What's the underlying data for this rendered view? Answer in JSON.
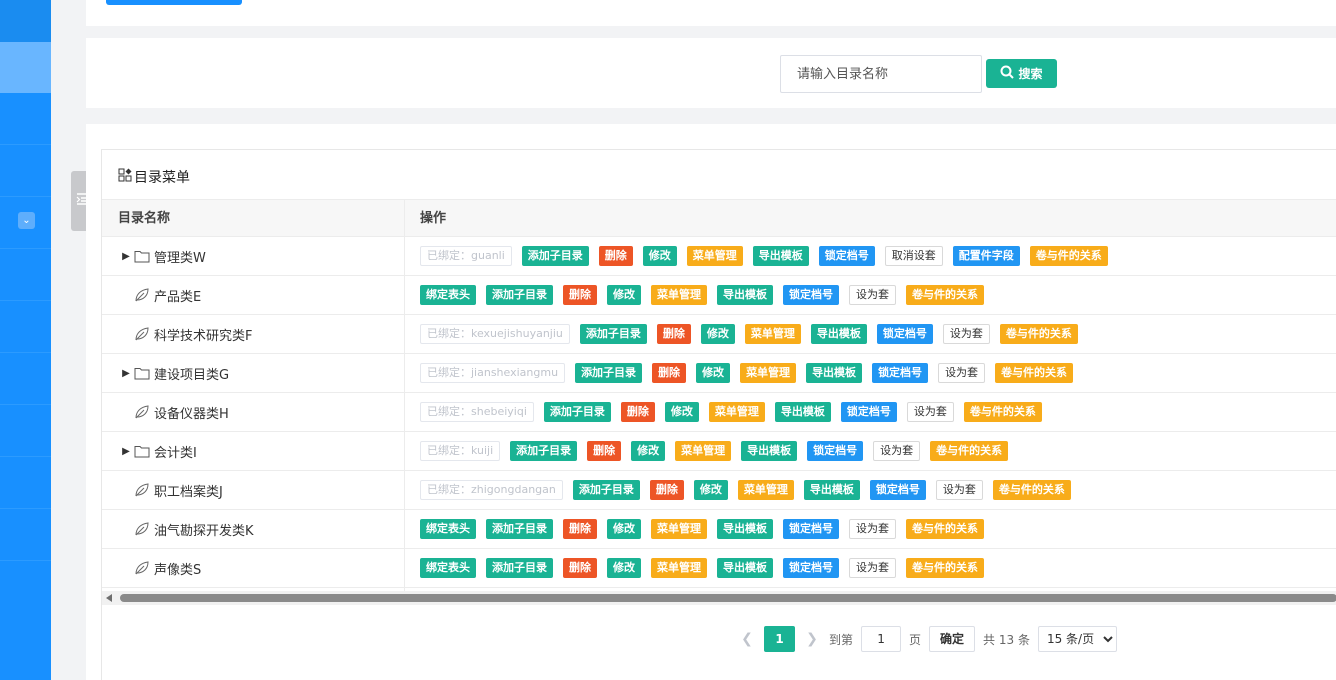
{
  "search": {
    "placeholder": "请输入目录名称",
    "button_label": "搜索"
  },
  "panel": {
    "title": "目录菜单"
  },
  "table": {
    "columns": [
      "目录名称",
      "操作"
    ],
    "rows": [
      {
        "name": "管理类W",
        "expandable": true,
        "icon": "folder-icon",
        "actions": [
          {
            "label": "已绑定：guanli",
            "style": "disabled"
          },
          {
            "label": "添加子目录",
            "style": "teal"
          },
          {
            "label": "删除",
            "style": "red"
          },
          {
            "label": "修改",
            "style": "teal"
          },
          {
            "label": "菜单管理",
            "style": "orange"
          },
          {
            "label": "导出模板",
            "style": "teal"
          },
          {
            "label": "锁定档号",
            "style": "blue"
          },
          {
            "label": "取消设套",
            "style": "outline"
          },
          {
            "label": "配置件字段",
            "style": "blue"
          },
          {
            "label": "卷与件的关系",
            "style": "orange"
          }
        ]
      },
      {
        "name": "产品类E",
        "expandable": false,
        "icon": "leaf-icon",
        "actions": [
          {
            "label": "绑定表头",
            "style": "teal"
          },
          {
            "label": "添加子目录",
            "style": "teal"
          },
          {
            "label": "删除",
            "style": "red"
          },
          {
            "label": "修改",
            "style": "teal"
          },
          {
            "label": "菜单管理",
            "style": "orange"
          },
          {
            "label": "导出模板",
            "style": "teal"
          },
          {
            "label": "锁定档号",
            "style": "blue"
          },
          {
            "label": "设为套",
            "style": "outline"
          },
          {
            "label": "卷与件的关系",
            "style": "orange"
          }
        ]
      },
      {
        "name": "科学技术研究类F",
        "expandable": false,
        "icon": "leaf-icon",
        "actions": [
          {
            "label": "已绑定：kexuejishuyanjiu",
            "style": "disabled"
          },
          {
            "label": "添加子目录",
            "style": "teal"
          },
          {
            "label": "删除",
            "style": "red"
          },
          {
            "label": "修改",
            "style": "teal"
          },
          {
            "label": "菜单管理",
            "style": "orange"
          },
          {
            "label": "导出模板",
            "style": "teal"
          },
          {
            "label": "锁定档号",
            "style": "blue"
          },
          {
            "label": "设为套",
            "style": "outline"
          },
          {
            "label": "卷与件的关系",
            "style": "orange"
          }
        ]
      },
      {
        "name": "建设项目类G",
        "expandable": true,
        "icon": "folder-icon",
        "actions": [
          {
            "label": "已绑定：jianshexiangmu",
            "style": "disabled"
          },
          {
            "label": "添加子目录",
            "style": "teal"
          },
          {
            "label": "删除",
            "style": "red"
          },
          {
            "label": "修改",
            "style": "teal"
          },
          {
            "label": "菜单管理",
            "style": "orange"
          },
          {
            "label": "导出模板",
            "style": "teal"
          },
          {
            "label": "锁定档号",
            "style": "blue"
          },
          {
            "label": "设为套",
            "style": "outline"
          },
          {
            "label": "卷与件的关系",
            "style": "orange"
          }
        ]
      },
      {
        "name": "设备仪器类H",
        "expandable": false,
        "icon": "leaf-icon",
        "actions": [
          {
            "label": "已绑定：shebeiyiqi",
            "style": "disabled"
          },
          {
            "label": "添加子目录",
            "style": "teal"
          },
          {
            "label": "删除",
            "style": "red"
          },
          {
            "label": "修改",
            "style": "teal"
          },
          {
            "label": "菜单管理",
            "style": "orange"
          },
          {
            "label": "导出模板",
            "style": "teal"
          },
          {
            "label": "锁定档号",
            "style": "blue"
          },
          {
            "label": "设为套",
            "style": "outline"
          },
          {
            "label": "卷与件的关系",
            "style": "orange"
          }
        ]
      },
      {
        "name": "会计类I",
        "expandable": true,
        "icon": "folder-icon",
        "actions": [
          {
            "label": "已绑定：kuiji",
            "style": "disabled"
          },
          {
            "label": "添加子目录",
            "style": "teal"
          },
          {
            "label": "删除",
            "style": "red"
          },
          {
            "label": "修改",
            "style": "teal"
          },
          {
            "label": "菜单管理",
            "style": "orange"
          },
          {
            "label": "导出模板",
            "style": "teal"
          },
          {
            "label": "锁定档号",
            "style": "blue"
          },
          {
            "label": "设为套",
            "style": "outline"
          },
          {
            "label": "卷与件的关系",
            "style": "orange"
          }
        ]
      },
      {
        "name": "职工档案类J",
        "expandable": false,
        "icon": "leaf-icon",
        "actions": [
          {
            "label": "已绑定：zhigongdangan",
            "style": "disabled"
          },
          {
            "label": "添加子目录",
            "style": "teal"
          },
          {
            "label": "删除",
            "style": "red"
          },
          {
            "label": "修改",
            "style": "teal"
          },
          {
            "label": "菜单管理",
            "style": "orange"
          },
          {
            "label": "导出模板",
            "style": "teal"
          },
          {
            "label": "锁定档号",
            "style": "blue"
          },
          {
            "label": "设为套",
            "style": "outline"
          },
          {
            "label": "卷与件的关系",
            "style": "orange"
          }
        ]
      },
      {
        "name": "油气勘探开发类K",
        "expandable": false,
        "icon": "leaf-icon",
        "actions": [
          {
            "label": "绑定表头",
            "style": "teal"
          },
          {
            "label": "添加子目录",
            "style": "teal"
          },
          {
            "label": "删除",
            "style": "red"
          },
          {
            "label": "修改",
            "style": "teal"
          },
          {
            "label": "菜单管理",
            "style": "orange"
          },
          {
            "label": "导出模板",
            "style": "teal"
          },
          {
            "label": "锁定档号",
            "style": "blue"
          },
          {
            "label": "设为套",
            "style": "outline"
          },
          {
            "label": "卷与件的关系",
            "style": "orange"
          }
        ]
      },
      {
        "name": "声像类S",
        "expandable": false,
        "icon": "leaf-icon",
        "actions": [
          {
            "label": "绑定表头",
            "style": "teal"
          },
          {
            "label": "添加子目录",
            "style": "teal"
          },
          {
            "label": "删除",
            "style": "red"
          },
          {
            "label": "修改",
            "style": "teal"
          },
          {
            "label": "菜单管理",
            "style": "orange"
          },
          {
            "label": "导出模板",
            "style": "teal"
          },
          {
            "label": "锁定档号",
            "style": "blue"
          },
          {
            "label": "设为套",
            "style": "outline"
          },
          {
            "label": "卷与件的关系",
            "style": "orange"
          }
        ]
      }
    ]
  },
  "pagination": {
    "current_page": "1",
    "goto_prefix": "到第",
    "goto_value": "1",
    "goto_suffix": "页",
    "confirm_label": "确定",
    "total_text": "共 13 条",
    "page_size": "15 条/页"
  },
  "colors": {
    "teal": "#1ab394",
    "red": "#ed5526",
    "orange": "#f8ac1a",
    "blue": "#2196f3",
    "sidebar": "#1890ff"
  }
}
